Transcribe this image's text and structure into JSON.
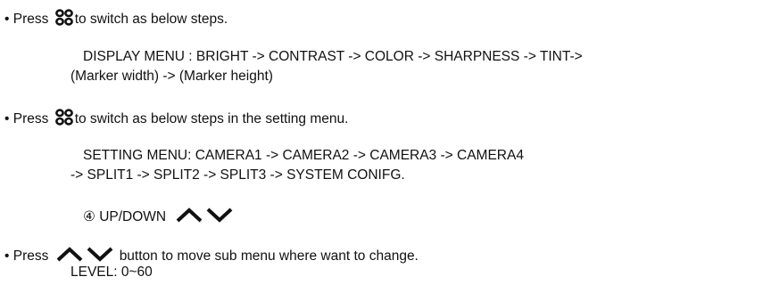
{
  "bullet": "•",
  "line1": {
    "before": "Press",
    "after": "to switch as below steps."
  },
  "display_menu": {
    "line_a": "DISPLAY MENU : BRIGHT -> CONTRAST -> COLOR -> SHARPNESS -> TINT->",
    "line_b": "(Marker width) -> (Marker height)"
  },
  "line2": {
    "before": "Press",
    "after": "to switch as below steps in the setting menu."
  },
  "setting_menu": {
    "line_a": "SETTING MENU: CAMERA1 -> CAMERA2 -> CAMERA3 -> CAMERA4",
    "line_b": "-> SPLIT1 -> SPLIT2 -> SPLIT3 -> SYSTEM CONIFG."
  },
  "updown": {
    "label": "④ UP/DOWN"
  },
  "line3": {
    "before": "Press",
    "after": "button to move sub menu where want to change."
  },
  "level": "LEVEL: 0~60",
  "icons": {
    "menu": "menu-rings-icon",
    "up": "chevron-up-icon",
    "down": "chevron-down-icon"
  }
}
